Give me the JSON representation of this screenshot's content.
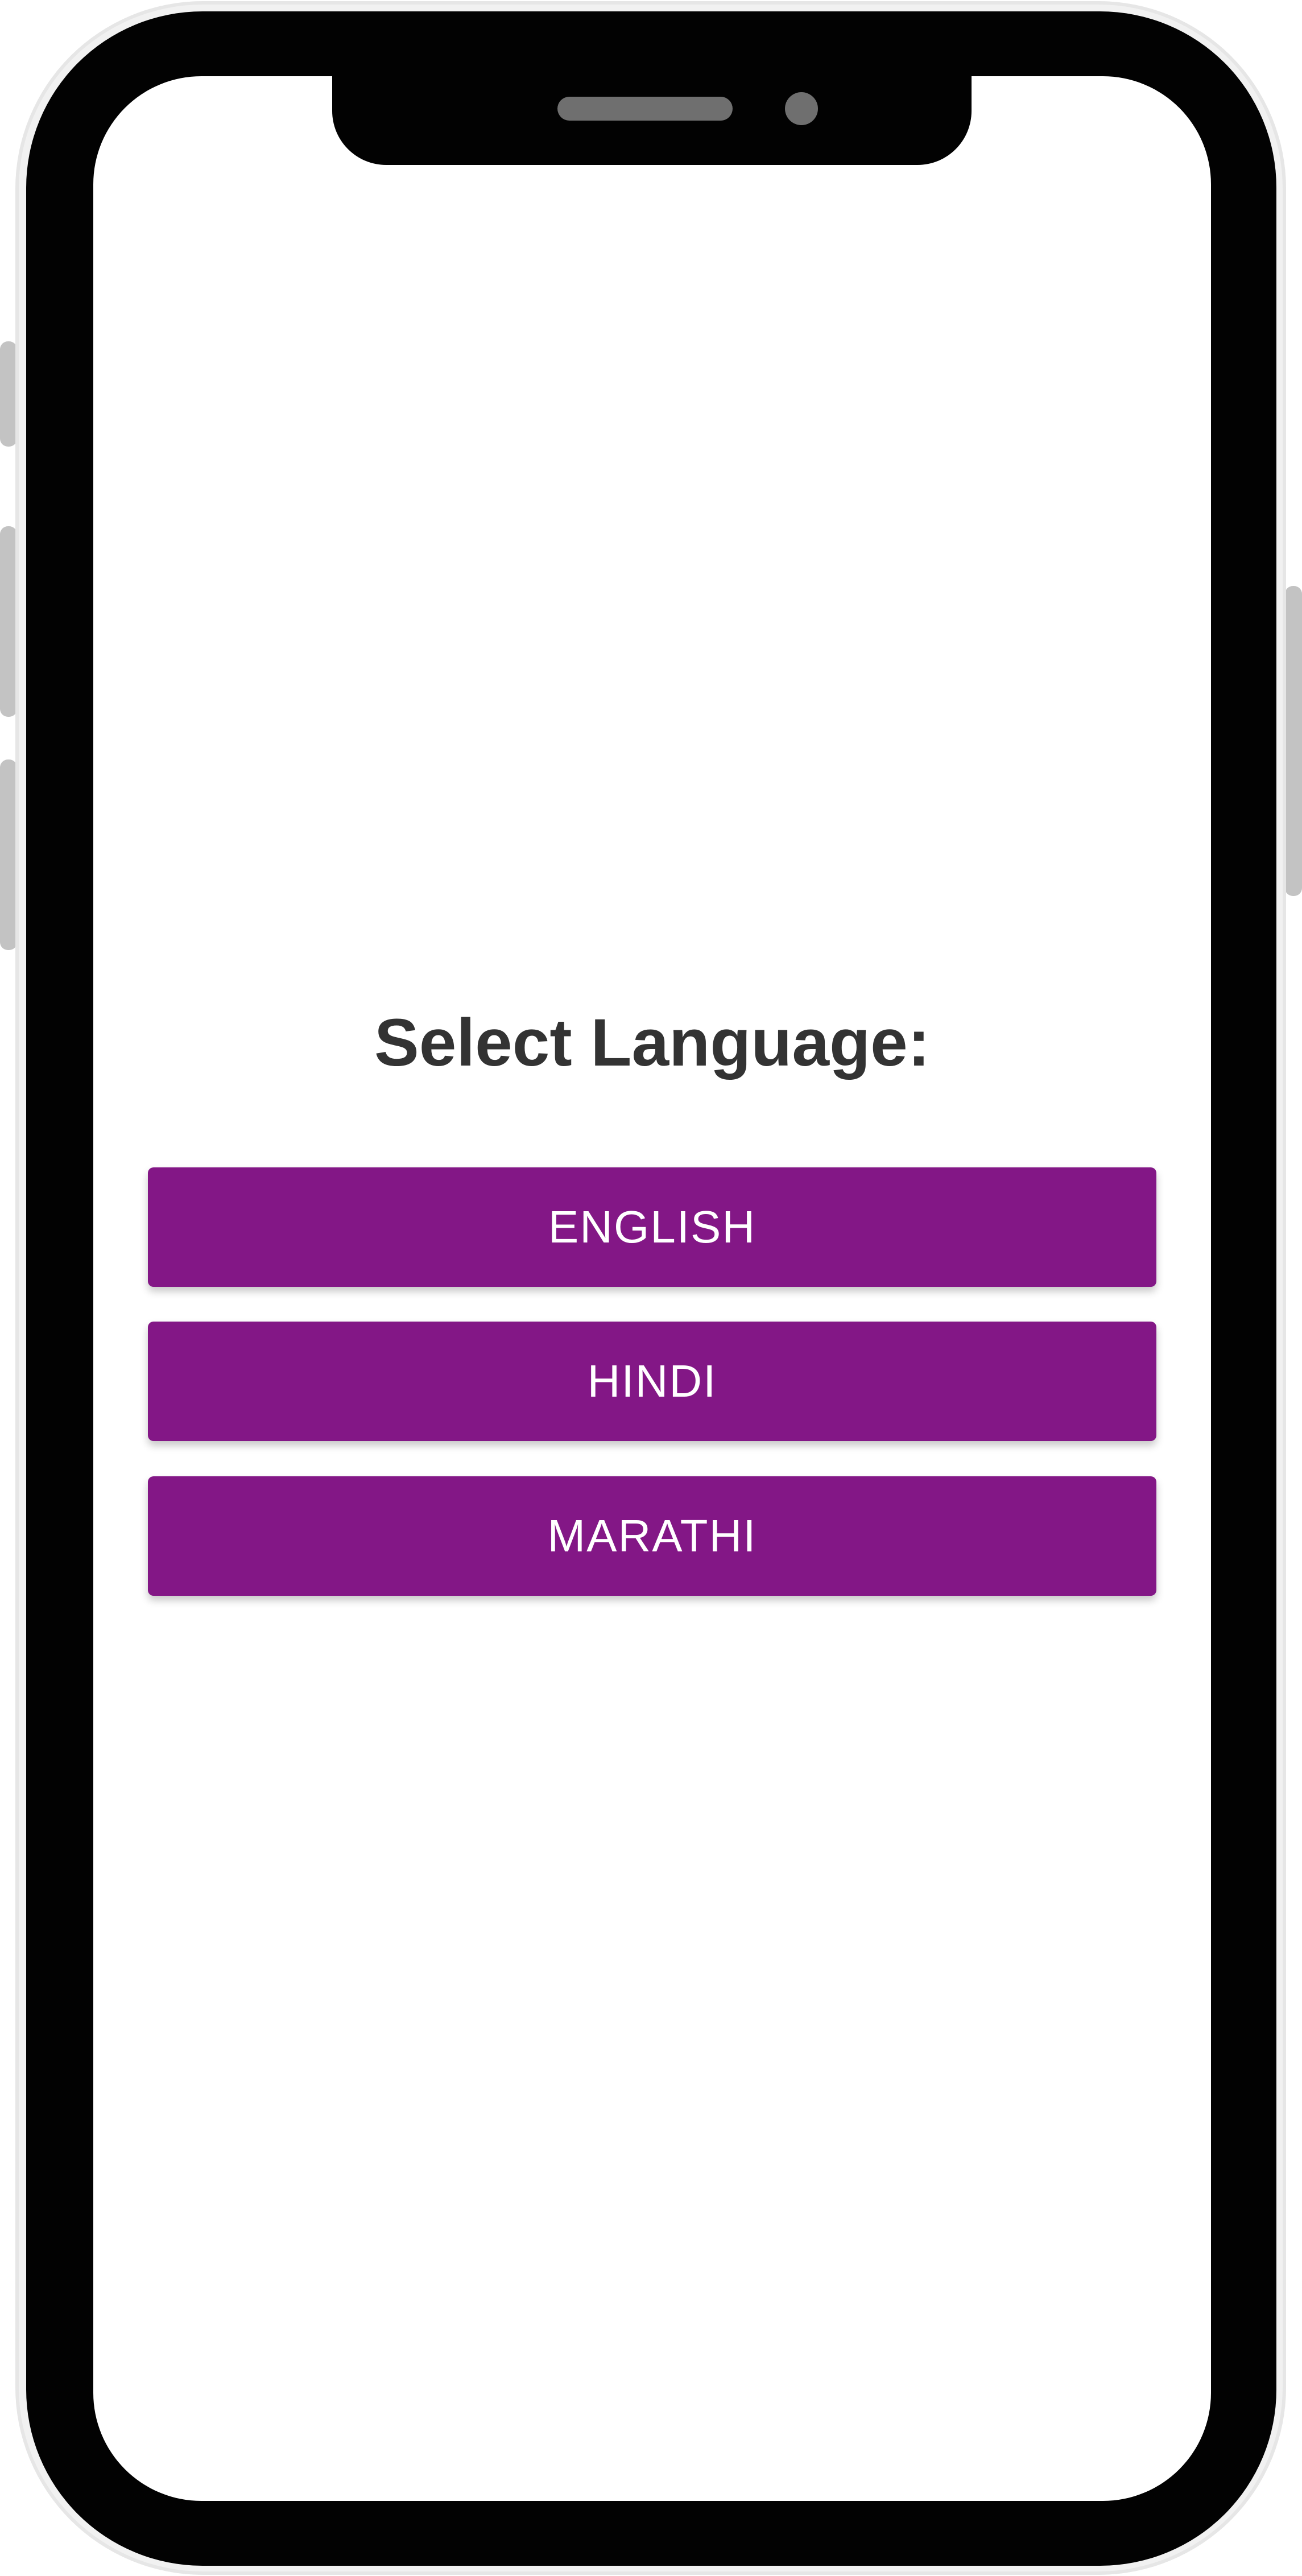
{
  "screen": {
    "title": "Select Language:"
  },
  "languages": [
    {
      "label": "ENGLISH"
    },
    {
      "label": "HINDI"
    },
    {
      "label": "MARATHI"
    }
  ],
  "colors": {
    "button_background": "#831786",
    "button_text": "#ffffff",
    "title_text": "#333333",
    "screen_background": "#ffffff",
    "device_frame": "#020202"
  }
}
